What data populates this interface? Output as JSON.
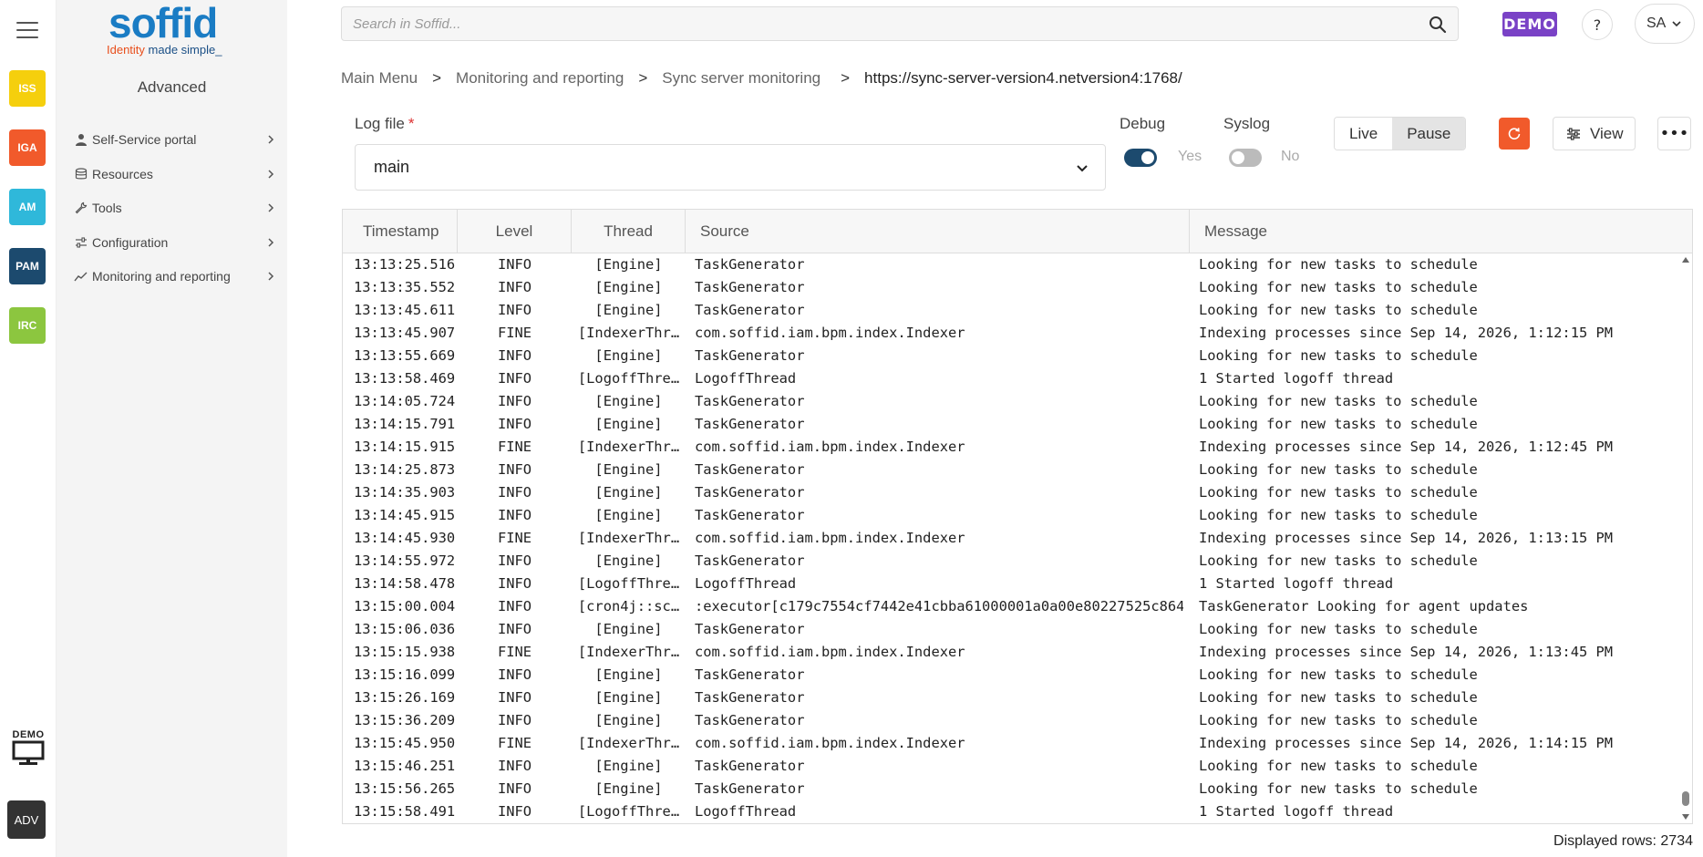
{
  "rail": {
    "apps": [
      {
        "label": "ISS",
        "color": "#f5cf0d"
      },
      {
        "label": "IGA",
        "color": "#f15a2b"
      },
      {
        "label": "AM",
        "color": "#2fb8da"
      },
      {
        "label": "PAM",
        "color": "#1c4a6e"
      },
      {
        "label": "IRC",
        "color": "#8cc63f"
      }
    ],
    "demo_label": "DEMO",
    "adv_label": "ADV"
  },
  "sidenav": {
    "logo_word": "soffid",
    "logo_tag_a": "Identity ",
    "logo_tag_b": "made simple_",
    "title": "Advanced",
    "items": [
      {
        "label": "Self-Service portal",
        "icon": "person-icon"
      },
      {
        "label": "Resources",
        "icon": "database-icon"
      },
      {
        "label": "Tools",
        "icon": "wrench-icon"
      },
      {
        "label": "Configuration",
        "icon": "sliders-icon"
      },
      {
        "label": "Monitoring and reporting",
        "icon": "trend-icon"
      }
    ]
  },
  "header": {
    "search_placeholder": "Search in Soffid...",
    "demo_badge": "DEMO",
    "help": "?",
    "user_initials": "SA"
  },
  "breadcrumb": [
    "Main Menu",
    "Monitoring and reporting",
    "Sync server monitoring",
    "https://sync-server-version4.netversion4:1768/"
  ],
  "filters": {
    "log_file_label": "Log file",
    "log_file_required": "*",
    "log_file_value": "main",
    "debug_label": "Debug",
    "debug_value": "Yes",
    "debug_on": true,
    "syslog_label": "Syslog",
    "syslog_value": "No",
    "syslog_on": false,
    "live_label": "Live",
    "pause_label": "Pause",
    "view_label": "View",
    "more_label": "•••",
    "accent_color": "#f15a2b",
    "toggle_on_color": "#1c4a6e"
  },
  "table": {
    "columns": [
      "Timestamp",
      "Level",
      "Thread",
      "Source",
      "Message"
    ],
    "rows": [
      [
        "13:13:25.516",
        "INFO",
        "[Engine]",
        "TaskGenerator",
        "Looking for new tasks to schedule"
      ],
      [
        "13:13:35.552",
        "INFO",
        "[Engine]",
        "TaskGenerator",
        "Looking for new tasks to schedule"
      ],
      [
        "13:13:45.611",
        "INFO",
        "[Engine]",
        "TaskGenerator",
        "Looking for new tasks to schedule"
      ],
      [
        "13:13:45.907",
        "FINE",
        "[IndexerThr…",
        "com.soffid.iam.bpm.index.Indexer",
        "Indexing processes since Sep 14, 2026, 1:12:15 PM"
      ],
      [
        "13:13:55.669",
        "INFO",
        "[Engine]",
        "TaskGenerator",
        "Looking for new tasks to schedule"
      ],
      [
        "13:13:58.469",
        "INFO",
        "[LogoffThre…",
        "LogoffThread",
        "1 Started logoff thread"
      ],
      [
        "13:14:05.724",
        "INFO",
        "[Engine]",
        "TaskGenerator",
        "Looking for new tasks to schedule"
      ],
      [
        "13:14:15.791",
        "INFO",
        "[Engine]",
        "TaskGenerator",
        "Looking for new tasks to schedule"
      ],
      [
        "13:14:15.915",
        "FINE",
        "[IndexerThr…",
        "com.soffid.iam.bpm.index.Indexer",
        "Indexing processes since Sep 14, 2026, 1:12:45 PM"
      ],
      [
        "13:14:25.873",
        "INFO",
        "[Engine]",
        "TaskGenerator",
        "Looking for new tasks to schedule"
      ],
      [
        "13:14:35.903",
        "INFO",
        "[Engine]",
        "TaskGenerator",
        "Looking for new tasks to schedule"
      ],
      [
        "13:14:45.915",
        "INFO",
        "[Engine]",
        "TaskGenerator",
        "Looking for new tasks to schedule"
      ],
      [
        "13:14:45.930",
        "FINE",
        "[IndexerThr…",
        "com.soffid.iam.bpm.index.Indexer",
        "Indexing processes since Sep 14, 2026, 1:13:15 PM"
      ],
      [
        "13:14:55.972",
        "INFO",
        "[Engine]",
        "TaskGenerator",
        "Looking for new tasks to schedule"
      ],
      [
        "13:14:58.478",
        "INFO",
        "[LogoffThre…",
        "LogoffThread",
        "1 Started logoff thread"
      ],
      [
        "13:15:00.004",
        "INFO",
        "[cron4j::sc…",
        ":executor[c179c7554cf7442e41cbba61000001a0a00e80227525c864…",
        "TaskGenerator Looking for agent updates"
      ],
      [
        "13:15:06.036",
        "INFO",
        "[Engine]",
        "TaskGenerator",
        "Looking for new tasks to schedule"
      ],
      [
        "13:15:15.938",
        "FINE",
        "[IndexerThr…",
        "com.soffid.iam.bpm.index.Indexer",
        "Indexing processes since Sep 14, 2026, 1:13:45 PM"
      ],
      [
        "13:15:16.099",
        "INFO",
        "[Engine]",
        "TaskGenerator",
        "Looking for new tasks to schedule"
      ],
      [
        "13:15:26.169",
        "INFO",
        "[Engine]",
        "TaskGenerator",
        "Looking for new tasks to schedule"
      ],
      [
        "13:15:36.209",
        "INFO",
        "[Engine]",
        "TaskGenerator",
        "Looking for new tasks to schedule"
      ],
      [
        "13:15:45.950",
        "FINE",
        "[IndexerThr…",
        "com.soffid.iam.bpm.index.Indexer",
        "Indexing processes since Sep 14, 2026, 1:14:15 PM"
      ],
      [
        "13:15:46.251",
        "INFO",
        "[Engine]",
        "TaskGenerator",
        "Looking for new tasks to schedule"
      ],
      [
        "13:15:56.265",
        "INFO",
        "[Engine]",
        "TaskGenerator",
        "Looking for new tasks to schedule"
      ],
      [
        "13:15:58.491",
        "INFO",
        "[LogoffThre…",
        "LogoffThread",
        "1 Started logoff thread"
      ]
    ],
    "displayed_rows_label": "Displayed rows: 2734"
  }
}
